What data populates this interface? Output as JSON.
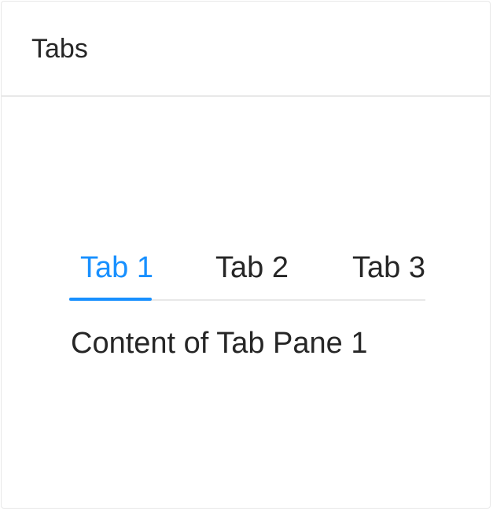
{
  "card": {
    "title": "Tabs"
  },
  "tabs": {
    "items": [
      {
        "label": "Tab 1",
        "active": true
      },
      {
        "label": "Tab 2",
        "active": false
      },
      {
        "label": "Tab 3",
        "active": false
      }
    ],
    "active_content": "Content of Tab Pane 1"
  },
  "colors": {
    "accent": "#1890ff",
    "text": "#262626",
    "border": "#e8e8e8"
  }
}
